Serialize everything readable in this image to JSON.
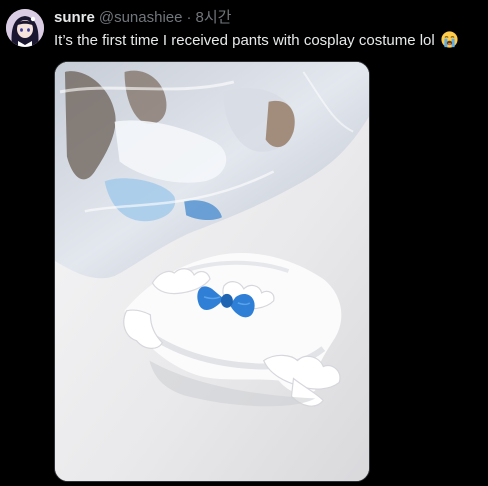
{
  "tweet": {
    "display_name": "sunre",
    "handle": "@sunashiee",
    "separator": "·",
    "time": "8시간",
    "text": "It’s the first time I received pants with cosplay costume lol",
    "emoji": "loudly-crying-face-emoji",
    "avatar_icon": "anime-avatar",
    "media_icon": "photo-cosplay-pants-and-plastic-bag"
  },
  "colors": {
    "background": "#000000",
    "primary_text": "#e7e9ea",
    "secondary_text": "#71767b",
    "bow_blue": "#2f7fd6"
  }
}
